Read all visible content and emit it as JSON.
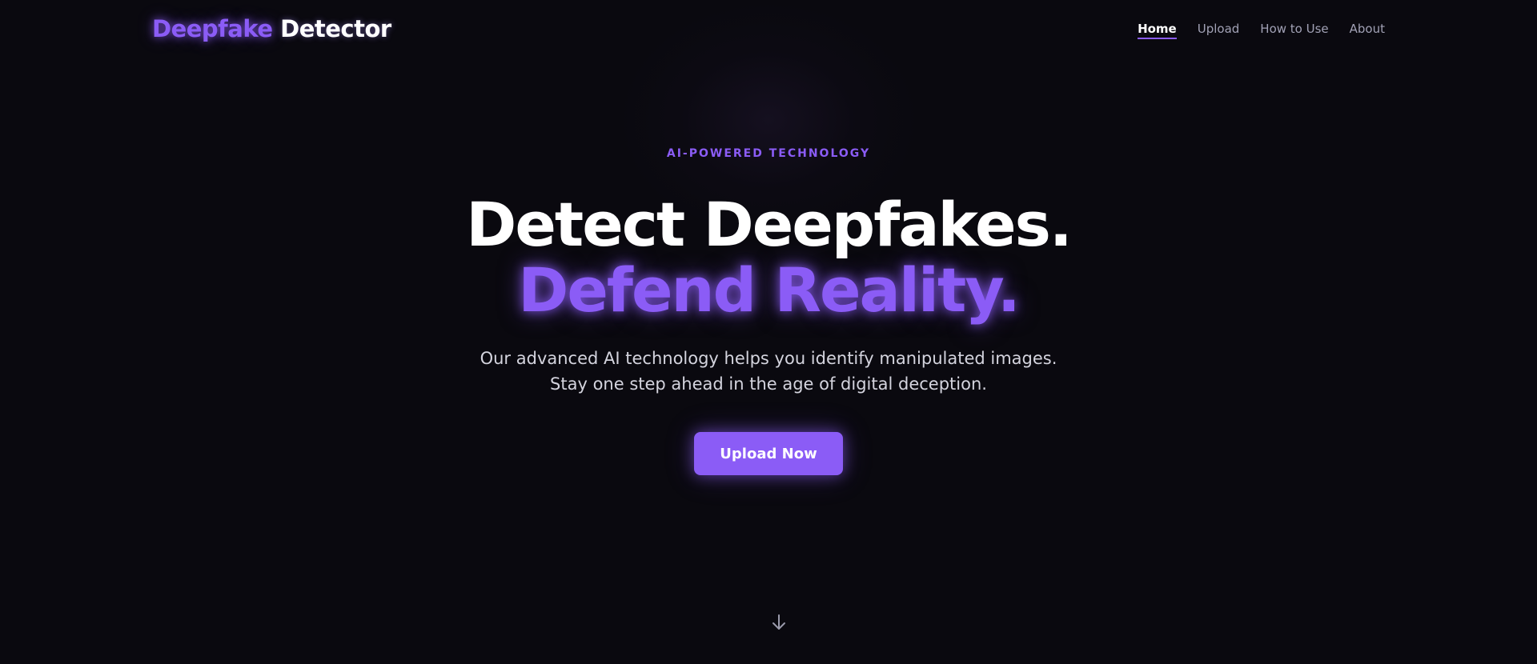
{
  "nav": {
    "logo_accent": "Deepfake",
    "logo_main": " Detector",
    "links": [
      {
        "label": "Home",
        "active": true
      },
      {
        "label": "Upload",
        "active": false
      },
      {
        "label": "How to Use",
        "active": false
      },
      {
        "label": "About",
        "active": false
      }
    ]
  },
  "hero": {
    "eyebrow": "AI-POWERED TECHNOLOGY",
    "headline_line1": "Detect Deepfakes.",
    "headline_line2": "Defend Reality.",
    "subtitle": "Our advanced AI technology helps you identify manipulated images. Stay one step ahead in the age of digital deception.",
    "cta_label": "Upload Now",
    "scroll_icon": "arrow-down-icon"
  },
  "colors": {
    "background": "#0a090f",
    "accent": "#8b5cf6",
    "text_primary": "#ffffff",
    "text_muted": "#a1a1b5"
  }
}
